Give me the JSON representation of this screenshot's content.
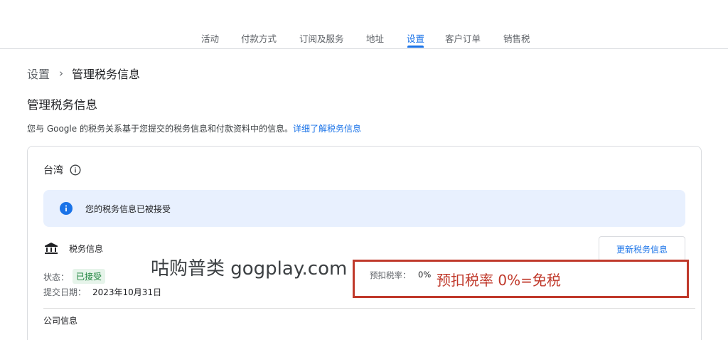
{
  "nav": {
    "tabs": [
      {
        "label": "活动",
        "active": false
      },
      {
        "label": "付款方式",
        "active": false
      },
      {
        "label": "订阅及服务",
        "active": false
      },
      {
        "label": "地址",
        "active": false
      },
      {
        "label": "设置",
        "active": true
      },
      {
        "label": "客户订单",
        "active": false
      },
      {
        "label": "销售税",
        "active": false
      }
    ]
  },
  "breadcrumb": {
    "parent": "设置",
    "separator": "›",
    "current": "管理税务信息"
  },
  "page": {
    "title": "管理税务信息",
    "description": "您与 Google 的税务关系基于您提交的税务信息和付款资料中的信息。",
    "learn_more_link": "详细了解税务信息"
  },
  "card": {
    "country": "台湾",
    "banner_text": "您的税务信息已被接受",
    "tax_info_label": "税务信息",
    "update_button": "更新税务信息",
    "status_label": "状态：",
    "status_value": "已接受",
    "date_label": "提交日期：",
    "date_value": "2023年10月31日",
    "withholding_label": "预扣税率：",
    "withholding_value": "0%",
    "company_label": "公司信息"
  },
  "overlay": {
    "watermark": "咕购普类 gogplay.com",
    "annotation": "预扣税率 0%=免税"
  },
  "colors": {
    "accent": "#1a73e8",
    "success": "#188038",
    "success_bg": "#e6f4ea",
    "banner_bg": "#e8f0fe",
    "annotation": "#c0392b"
  },
  "icons": {
    "country_info": "info-outline-icon",
    "banner": "info-filled-icon",
    "tax_info": "bank-icon"
  }
}
